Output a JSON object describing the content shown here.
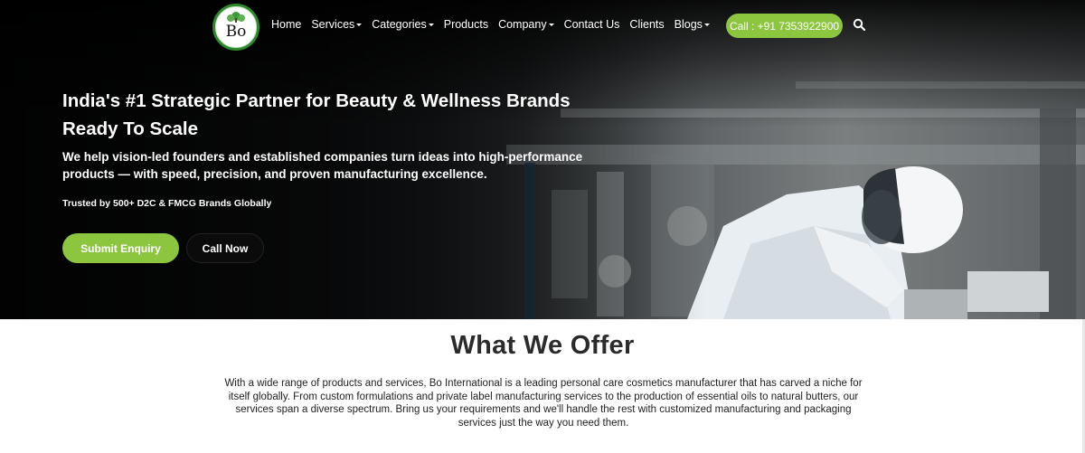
{
  "nav": {
    "logo_text": "Bo",
    "items": [
      {
        "label": "Home",
        "dropdown": false
      },
      {
        "label": "Services",
        "dropdown": true
      },
      {
        "label": "Categories",
        "dropdown": true
      },
      {
        "label": "Products",
        "dropdown": false
      },
      {
        "label": "Company",
        "dropdown": true
      },
      {
        "label": "Contact Us",
        "dropdown": false
      },
      {
        "label": "Clients",
        "dropdown": false
      },
      {
        "label": "Blogs",
        "dropdown": true
      }
    ],
    "call_label": "Call : +91 7353922900",
    "search_icon": "search-icon"
  },
  "hero": {
    "headline_line1": "India's #1 Strategic Partner for Beauty & Wellness Brands",
    "headline_line2": "Ready To Scale",
    "subtext": "We help vision-led founders and established companies turn ideas into high-performance products — with speed, precision, and proven manufacturing excellence.",
    "trust": "Trusted by 500+ D2C & FMCG Brands Globally",
    "enquiry_label": "Submit Enquiry",
    "callnow_label": "Call Now"
  },
  "offer": {
    "title": "What We Offer",
    "text": "With a wide range of products and services, Bo International is a leading personal care cosmetics manufacturer that has carved a niche for itself globally. From custom formulations and private label manufacturing services to the production of essential oils to natural butters, our services span a diverse spectrum. Bring us your requirements and we'll handle the rest with customized manufacturing and packaging services just the way you need them."
  },
  "colors": {
    "accent_green": "#8cc63f",
    "logo_green": "#2f8a2f",
    "dark_button": "#0b0b0b"
  }
}
